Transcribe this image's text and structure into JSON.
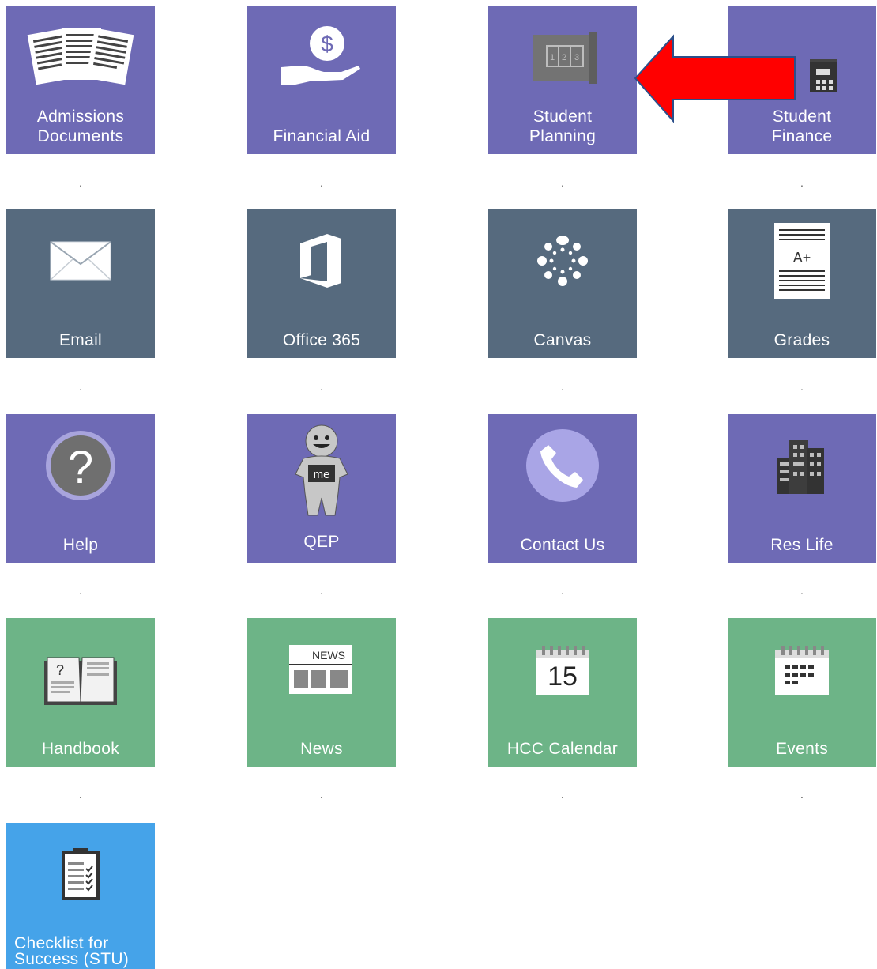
{
  "tiles": [
    {
      "id": "admissions-documents",
      "label": "Admissions Documents",
      "icon": "documents-icon",
      "color": "purple"
    },
    {
      "id": "financial-aid",
      "label": "Financial Aid",
      "icon": "money-hand-icon",
      "color": "purple"
    },
    {
      "id": "student-planning",
      "label": "Student Planning",
      "icon": "blueprint-icon",
      "color": "purple"
    },
    {
      "id": "student-finance",
      "label": "Student Finance",
      "icon": "calculator-icon",
      "color": "purple"
    },
    {
      "id": "email",
      "label": "Email",
      "icon": "envelope-icon",
      "color": "slate"
    },
    {
      "id": "office-365",
      "label": "Office 365",
      "icon": "office-logo-icon",
      "color": "slate"
    },
    {
      "id": "canvas",
      "label": "Canvas",
      "icon": "canvas-logo-icon",
      "color": "slate"
    },
    {
      "id": "grades",
      "label": "Grades",
      "icon": "grade-report-icon",
      "color": "slate"
    },
    {
      "id": "help",
      "label": "Help",
      "icon": "question-icon",
      "color": "purple"
    },
    {
      "id": "qep",
      "label": "QEP",
      "icon": "mascot-icon",
      "color": "purple"
    },
    {
      "id": "contact-us",
      "label": "Contact Us",
      "icon": "phone-icon",
      "color": "purple"
    },
    {
      "id": "res-life",
      "label": "Res Life",
      "icon": "buildings-icon",
      "color": "purple"
    },
    {
      "id": "handbook",
      "label": "Handbook",
      "icon": "book-icon",
      "color": "green"
    },
    {
      "id": "news",
      "label": "News",
      "icon": "newspaper-icon",
      "color": "green"
    },
    {
      "id": "hcc-calendar",
      "label": "HCC Calendar",
      "icon": "calendar-icon",
      "color": "green"
    },
    {
      "id": "events",
      "label": "Events",
      "icon": "events-calendar-icon",
      "color": "green"
    },
    {
      "id": "checklist-for-success",
      "label": "Checklist for Success (STU)",
      "icon": "clipboard-icon",
      "color": "blue"
    }
  ],
  "label_lines": {
    "admissions-documents": [
      "Admissions",
      "Documents"
    ],
    "student-planning": [
      "Student",
      "Planning"
    ],
    "student-finance": [
      "Student",
      "Finance"
    ],
    "checklist-for-success": [
      "Checklist for",
      "Success (STU)"
    ]
  },
  "separator": ".",
  "icon_text": {
    "grade": "A+",
    "qep_badge": "me",
    "news": "NEWS",
    "calendar_day": "15",
    "planning_steps": [
      "1",
      "2",
      "3"
    ],
    "dollar": "$",
    "question": "?"
  },
  "annotation": {
    "arrow_color": "#ff0000",
    "arrow_outline": "#2b4f8a"
  }
}
